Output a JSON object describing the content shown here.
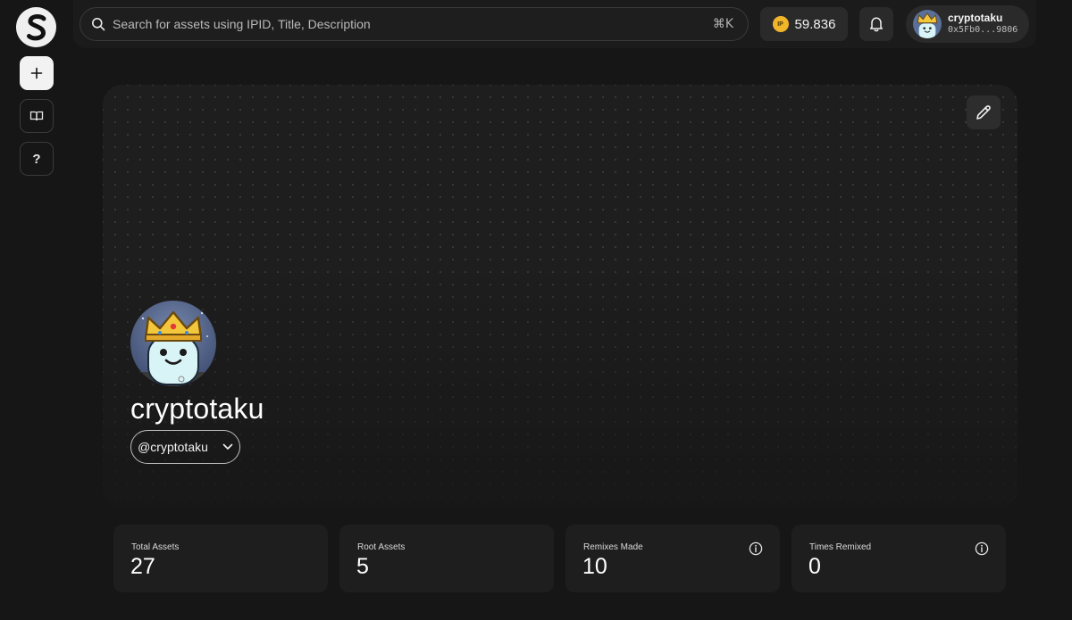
{
  "app": {
    "logo_icon": "story-s-logo-icon"
  },
  "sidebar": {
    "items": [
      {
        "name": "add",
        "icon": "plus-icon"
      },
      {
        "name": "docs",
        "icon": "book-icon"
      },
      {
        "name": "help",
        "icon": "question-icon",
        "label": "?"
      }
    ]
  },
  "search": {
    "placeholder": "Search for assets using IPID, Title, Description",
    "shortcut": "⌘K"
  },
  "wallet": {
    "token_label": "IP",
    "balance": "59.836"
  },
  "user": {
    "name": "cryptotaku",
    "address": "0x5Fb0...9806"
  },
  "profile": {
    "name": "cryptotaku",
    "handle": "@cryptotaku"
  },
  "stats": [
    {
      "label": "Total Assets",
      "value": "27",
      "info": false
    },
    {
      "label": "Root Assets",
      "value": "5",
      "info": false
    },
    {
      "label": "Remixes Made",
      "value": "10",
      "info": true
    },
    {
      "label": "Times Remixed",
      "value": "0",
      "info": true
    }
  ],
  "colors": {
    "background": "#161616",
    "card": "#1e1e1e",
    "token": "#f1b52c",
    "avatar_bg": "#5a6f99",
    "crown": "#f3c73c"
  }
}
